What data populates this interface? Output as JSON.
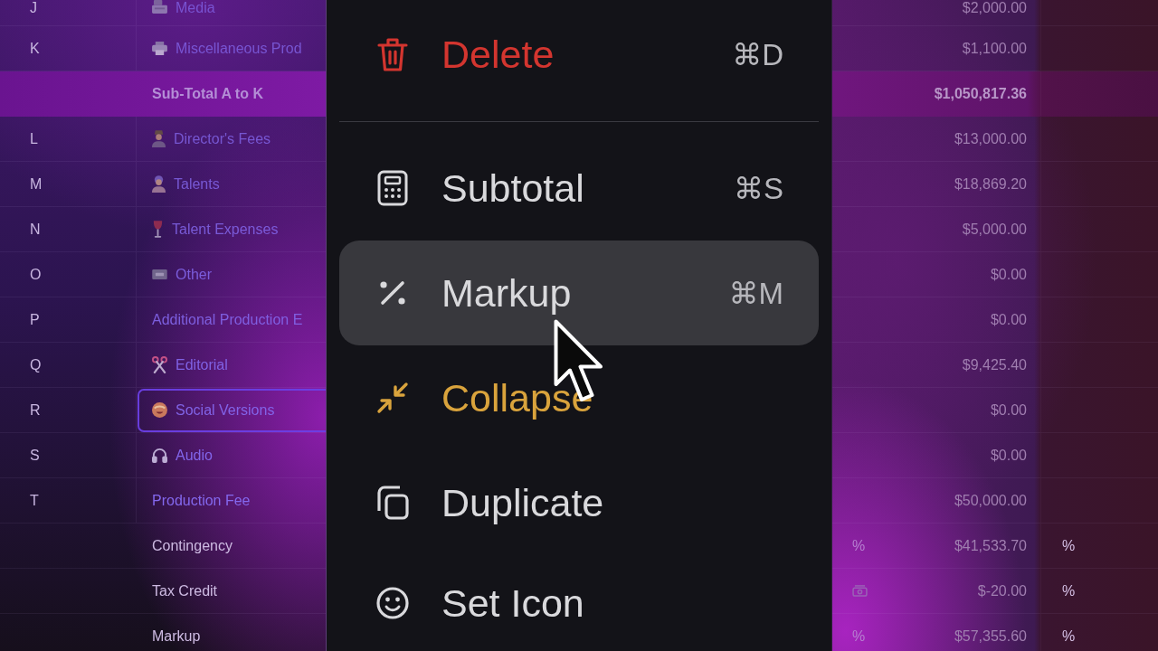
{
  "table": {
    "rows": [
      {
        "kind": "line",
        "letter": "J",
        "name": "Media",
        "amount": "$2,000.00",
        "selected": false
      },
      {
        "kind": "line",
        "letter": "K",
        "name": "Miscellaneous Prod",
        "amount": "$1,100.00",
        "selected": false
      },
      {
        "kind": "subtotal",
        "name": "Sub-Total A to K",
        "amount": "$1,050,817.36",
        "selected": false
      },
      {
        "kind": "line",
        "letter": "L",
        "name": "Director's Fees",
        "amount": "$13,000.00",
        "selected": false
      },
      {
        "kind": "line",
        "letter": "M",
        "name": "Talents",
        "amount": "$18,869.20",
        "selected": false
      },
      {
        "kind": "line",
        "letter": "N",
        "name": "Talent Expenses",
        "amount": "$5,000.00",
        "selected": false
      },
      {
        "kind": "line",
        "letter": "O",
        "name": "Other",
        "amount": "$0.00",
        "selected": false
      },
      {
        "kind": "line",
        "letter": "P",
        "name": "Additional Production E",
        "amount": "$0.00",
        "selected": false
      },
      {
        "kind": "line",
        "letter": "Q",
        "name": "Editorial",
        "amount": "$9,425.40",
        "selected": false
      },
      {
        "kind": "line",
        "letter": "R",
        "name": "Social Versions",
        "amount": "$0.00",
        "selected": true
      },
      {
        "kind": "line",
        "letter": "S",
        "name": "Audio",
        "amount": "$0.00",
        "selected": false
      },
      {
        "kind": "line",
        "letter": "T",
        "name": "Production Fee",
        "amount": "$50,000.00",
        "selected": false
      },
      {
        "kind": "adjustment",
        "name": "Contingency",
        "basis": "%",
        "amount": "$41,533.70",
        "unit": "%",
        "selected": false
      },
      {
        "kind": "adjustment",
        "name": "Tax Credit",
        "amount": "$-20.00",
        "unit": "%",
        "selected": false
      },
      {
        "kind": "adjustment",
        "name": "Markup",
        "basis": "%",
        "amount": "$57,355.60",
        "unit": "%",
        "selected": false
      }
    ]
  },
  "context_menu": {
    "items": [
      {
        "kind": "danger",
        "label": "Delete",
        "shortcut": "⌘D",
        "selected": false
      },
      {
        "kind": "separator"
      },
      {
        "kind": "normal",
        "label": "Subtotal",
        "shortcut": "⌘S",
        "selected": false
      },
      {
        "kind": "normal",
        "label": "Markup",
        "shortcut": "⌘M",
        "selected": true
      },
      {
        "kind": "accent",
        "label": "Collapse",
        "selected": false
      },
      {
        "kind": "normal",
        "label": "Duplicate",
        "selected": false
      },
      {
        "kind": "normal",
        "label": "Set Icon",
        "selected": false
      }
    ]
  }
}
